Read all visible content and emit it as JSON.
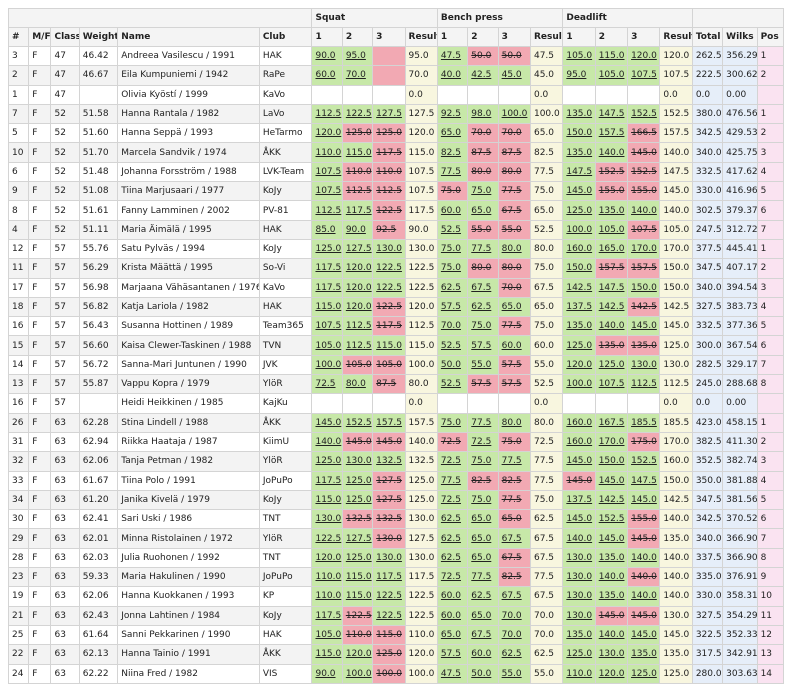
{
  "header": {
    "groups": {
      "squat": "Squat",
      "bench": "Bench press",
      "deadlift": "Deadlift"
    },
    "columns": {
      "num": "#",
      "sex": "M/F",
      "cls": "Class",
      "weight": "Weight",
      "name": "Name",
      "club": "Club",
      "a1": "1",
      "a2": "2",
      "a3": "3",
      "result": "Result",
      "total": "Total",
      "wilks": "Wilks",
      "pos": "Pos"
    }
  },
  "rows": [
    [
      "3",
      "F",
      "47",
      "46.42",
      "Andreea Vasilescu / 1991",
      "HAK",
      "90.0",
      "ok",
      "95.0",
      "ok",
      "",
      "fail",
      "95.0",
      "47.5",
      "ok",
      "50.0",
      "fail",
      "50.0",
      "fail",
      "47.5",
      "105.0",
      "ok",
      "115.0",
      "ok",
      "120.0",
      "ok",
      "120.0",
      "262.5",
      "356.29",
      "1"
    ],
    [
      "2",
      "F",
      "47",
      "46.67",
      "Eila Kumpuniemi / 1942",
      "RaPe",
      "60.0",
      "ok",
      "70.0",
      "ok",
      "",
      "fail",
      "70.0",
      "40.0",
      "ok",
      "42.5",
      "ok",
      "45.0",
      "ok",
      "45.0",
      "95.0",
      "ok",
      "105.0",
      "ok",
      "107.5",
      "ok",
      "107.5",
      "222.5",
      "300.62",
      "2"
    ],
    [
      "1",
      "F",
      "47",
      "",
      "Olivia Kyöstí / 1999",
      "KaVo",
      "",
      "",
      "",
      "",
      "",
      "",
      "0.0",
      "",
      "",
      "",
      "",
      "",
      "",
      "0.0",
      "",
      "",
      "",
      "",
      "",
      "",
      "0.0",
      "0.0",
      "0.00",
      ""
    ],
    [
      "7",
      "F",
      "52",
      "51.58",
      "Hanna Rantala / 1982",
      "LaVo",
      "112.5",
      "ok",
      "122.5",
      "ok",
      "127.5",
      "ok",
      "127.5",
      "92.5",
      "ok",
      "98.0",
      "ok",
      "100.0",
      "ok",
      "100.0",
      "135.0",
      "ok",
      "147.5",
      "ok",
      "152.5",
      "ok",
      "152.5",
      "380.0",
      "476.56",
      "1"
    ],
    [
      "5",
      "F",
      "52",
      "51.60",
      "Hanna Seppä / 1993",
      "HeTarmo",
      "120.0",
      "ok",
      "125.0",
      "fail",
      "125.0",
      "fail",
      "120.0",
      "65.0",
      "ok",
      "70.0",
      "fail",
      "70.0",
      "fail",
      "65.0",
      "150.0",
      "ok",
      "157.5",
      "ok",
      "166.5",
      "fail",
      "157.5",
      "342.5",
      "429.53",
      "2"
    ],
    [
      "10",
      "F",
      "52",
      "51.70",
      "Marcela Sandvik / 1974",
      "ÅKK",
      "110.0",
      "ok",
      "115.0",
      "ok",
      "117.5",
      "fail",
      "115.0",
      "82.5",
      "ok",
      "87.5",
      "fail",
      "87.5",
      "fail",
      "82.5",
      "135.0",
      "ok",
      "140.0",
      "ok",
      "145.0",
      "fail",
      "140.0",
      "340.0",
      "425.75",
      "3"
    ],
    [
      "6",
      "F",
      "52",
      "51.48",
      "Johanna Forsström / 1988",
      "LVK-Team",
      "107.5",
      "ok",
      "110.0",
      "fail",
      "110.0",
      "fail",
      "107.5",
      "77.5",
      "ok",
      "80.0",
      "fail",
      "80.0",
      "fail",
      "77.5",
      "147.5",
      "ok",
      "152.5",
      "fail",
      "152.5",
      "fail",
      "147.5",
      "332.5",
      "417.62",
      "4"
    ],
    [
      "9",
      "F",
      "52",
      "51.08",
      "Tiina Marjusaari / 1977",
      "KoJy",
      "107.5",
      "ok",
      "112.5",
      "fail",
      "112.5",
      "fail",
      "107.5",
      "75.0",
      "fail",
      "75.0",
      "ok",
      "77.5",
      "fail",
      "75.0",
      "145.0",
      "ok",
      "155.0",
      "fail",
      "155.0",
      "fail",
      "145.0",
      "330.0",
      "416.96",
      "5"
    ],
    [
      "8",
      "F",
      "52",
      "51.61",
      "Fanny Lamminen / 2002",
      "PV-81",
      "112.5",
      "ok",
      "117.5",
      "ok",
      "122.5",
      "fail",
      "117.5",
      "60.0",
      "ok",
      "65.0",
      "ok",
      "67.5",
      "fail",
      "65.0",
      "125.0",
      "ok",
      "135.0",
      "ok",
      "140.0",
      "ok",
      "140.0",
      "302.5",
      "379.37",
      "6"
    ],
    [
      "4",
      "F",
      "52",
      "51.11",
      "Maria Äimälä / 1995",
      "HAK",
      "85.0",
      "ok",
      "90.0",
      "ok",
      "92.5",
      "fail",
      "90.0",
      "52.5",
      "ok",
      "55.0",
      "fail",
      "55.0",
      "fail",
      "52.5",
      "100.0",
      "ok",
      "105.0",
      "ok",
      "107.5",
      "fail",
      "105.0",
      "247.5",
      "312.72",
      "7"
    ],
    [
      "12",
      "F",
      "57",
      "55.76",
      "Satu Pylväs / 1994",
      "KoJy",
      "125.0",
      "ok",
      "127.5",
      "ok",
      "130.0",
      "ok",
      "130.0",
      "75.0",
      "ok",
      "77.5",
      "ok",
      "80.0",
      "ok",
      "80.0",
      "160.0",
      "ok",
      "165.0",
      "ok",
      "170.0",
      "ok",
      "170.0",
      "377.5",
      "445.41",
      "1"
    ],
    [
      "11",
      "F",
      "57",
      "56.29",
      "Krista Määttä / 1995",
      "So-Vi",
      "117.5",
      "ok",
      "120.0",
      "ok",
      "122.5",
      "ok",
      "122.5",
      "75.0",
      "ok",
      "80.0",
      "fail",
      "80.0",
      "fail",
      "75.0",
      "150.0",
      "ok",
      "157.5",
      "fail",
      "157.5",
      "fail",
      "150.0",
      "347.5",
      "407.17",
      "2"
    ],
    [
      "17",
      "F",
      "57",
      "56.98",
      "Marjaana Vähäsantanen / 1976",
      "KaVo",
      "117.5",
      "ok",
      "120.0",
      "ok",
      "122.5",
      "ok",
      "122.5",
      "62.5",
      "ok",
      "67.5",
      "ok",
      "70.0",
      "fail",
      "67.5",
      "142.5",
      "ok",
      "147.5",
      "ok",
      "150.0",
      "ok",
      "150.0",
      "340.0",
      "394.54",
      "3"
    ],
    [
      "18",
      "F",
      "57",
      "56.82",
      "Katja Lariola / 1982",
      "HAK",
      "115.0",
      "ok",
      "120.0",
      "ok",
      "122.5",
      "fail",
      "120.0",
      "57.5",
      "ok",
      "62.5",
      "ok",
      "65.0",
      "ok",
      "65.0",
      "137.5",
      "ok",
      "142.5",
      "ok",
      "142.5",
      "fail",
      "142.5",
      "327.5",
      "383.73",
      "4"
    ],
    [
      "16",
      "F",
      "57",
      "56.43",
      "Susanna Hottinen / 1989",
      "Team365",
      "107.5",
      "ok",
      "112.5",
      "ok",
      "117.5",
      "fail",
      "112.5",
      "70.0",
      "ok",
      "75.0",
      "ok",
      "77.5",
      "fail",
      "75.0",
      "135.0",
      "ok",
      "140.0",
      "ok",
      "145.0",
      "ok",
      "145.0",
      "332.5",
      "377.36",
      "5"
    ],
    [
      "15",
      "F",
      "57",
      "56.60",
      "Kaisa Clewer-Taskinen / 1988",
      "TVN",
      "105.0",
      "ok",
      "112.5",
      "ok",
      "115.0",
      "ok",
      "115.0",
      "52.5",
      "ok",
      "57.5",
      "ok",
      "60.0",
      "ok",
      "60.0",
      "125.0",
      "ok",
      "135.0",
      "fail",
      "135.0",
      "fail",
      "125.0",
      "300.0",
      "367.54",
      "6"
    ],
    [
      "14",
      "F",
      "57",
      "56.72",
      "Sanna-Mari Juntunen / 1990",
      "JVK",
      "100.0",
      "ok",
      "105.0",
      "fail",
      "105.0",
      "fail",
      "100.0",
      "50.0",
      "ok",
      "55.0",
      "ok",
      "57.5",
      "fail",
      "55.0",
      "120.0",
      "ok",
      "125.0",
      "ok",
      "130.0",
      "ok",
      "130.0",
      "282.5",
      "329.17",
      "7"
    ],
    [
      "13",
      "F",
      "57",
      "55.87",
      "Vappu Kopra / 1979",
      "YlöR",
      "72.5",
      "ok",
      "80.0",
      "ok",
      "87.5",
      "fail",
      "80.0",
      "52.5",
      "ok",
      "57.5",
      "fail",
      "57.5",
      "fail",
      "52.5",
      "100.0",
      "ok",
      "107.5",
      "ok",
      "112.5",
      "ok",
      "112.5",
      "245.0",
      "288.68",
      "8"
    ],
    [
      "16",
      "F",
      "57",
      "",
      "Heidi Heikkinen / 1985",
      "KajKu",
      "",
      "",
      "",
      "",
      "",
      "",
      "0.0",
      "",
      "",
      "",
      "",
      "",
      "",
      "0.0",
      "",
      "",
      "",
      "",
      "",
      "",
      "0.0",
      "0.0",
      "0.00",
      ""
    ],
    [
      "26",
      "F",
      "63",
      "62.28",
      "Stina Lindell / 1988",
      "ÅKK",
      "145.0",
      "ok",
      "152.5",
      "ok",
      "157.5",
      "ok",
      "157.5",
      "75.0",
      "ok",
      "77.5",
      "ok",
      "80.0",
      "ok",
      "80.0",
      "160.0",
      "ok",
      "167.5",
      "ok",
      "185.5",
      "ok",
      "185.5",
      "423.0",
      "458.15",
      "1"
    ],
    [
      "31",
      "F",
      "63",
      "62.94",
      "Riikka Haataja / 1987",
      "KiimU",
      "140.0",
      "ok",
      "145.0",
      "fail",
      "145.0",
      "fail",
      "140.0",
      "72.5",
      "fail",
      "72.5",
      "ok",
      "75.0",
      "fail",
      "72.5",
      "160.0",
      "ok",
      "170.0",
      "ok",
      "175.0",
      "fail",
      "170.0",
      "382.5",
      "411.30",
      "2"
    ],
    [
      "32",
      "F",
      "63",
      "62.06",
      "Tanja Petman / 1982",
      "YlöR",
      "125.0",
      "ok",
      "130.0",
      "ok",
      "132.5",
      "ok",
      "132.5",
      "72.5",
      "ok",
      "75.0",
      "ok",
      "77.5",
      "ok",
      "77.5",
      "145.0",
      "ok",
      "150.0",
      "ok",
      "152.5",
      "ok",
      "160.0",
      "352.5",
      "382.74",
      "3"
    ],
    [
      "33",
      "F",
      "63",
      "61.67",
      "Tiina Polo / 1991",
      "JoPuPo",
      "117.5",
      "ok",
      "125.0",
      "ok",
      "127.5",
      "fail",
      "125.0",
      "77.5",
      "ok",
      "82.5",
      "fail",
      "82.5",
      "fail",
      "77.5",
      "145.0",
      "fail",
      "145.0",
      "ok",
      "147.5",
      "ok",
      "150.0",
      "350.0",
      "381.88",
      "4"
    ],
    [
      "34",
      "F",
      "63",
      "61.20",
      "Janika Kivelä / 1979",
      "KoJy",
      "115.0",
      "ok",
      "125.0",
      "ok",
      "127.5",
      "fail",
      "125.0",
      "72.5",
      "ok",
      "75.0",
      "ok",
      "77.5",
      "fail",
      "75.0",
      "137.5",
      "ok",
      "142.5",
      "ok",
      "145.0",
      "ok",
      "142.5",
      "347.5",
      "381.56",
      "5"
    ],
    [
      "30",
      "F",
      "63",
      "62.41",
      "Sari Uski / 1986",
      "TNT",
      "130.0",
      "ok",
      "132.5",
      "fail",
      "132.5",
      "fail",
      "130.0",
      "62.5",
      "ok",
      "65.0",
      "ok",
      "65.0",
      "fail",
      "62.5",
      "145.0",
      "ok",
      "152.5",
      "ok",
      "155.0",
      "fail",
      "140.0",
      "342.5",
      "370.52",
      "6"
    ],
    [
      "29",
      "F",
      "63",
      "62.01",
      "Minna Ristolainen / 1972",
      "YlöR",
      "122.5",
      "ok",
      "127.5",
      "ok",
      "130.0",
      "fail",
      "127.5",
      "62.5",
      "ok",
      "65.0",
      "ok",
      "67.5",
      "ok",
      "67.5",
      "140.0",
      "ok",
      "145.0",
      "ok",
      "145.0",
      "fail",
      "135.0",
      "340.0",
      "366.90",
      "7"
    ],
    [
      "28",
      "F",
      "63",
      "62.03",
      "Julia Ruohonen / 1992",
      "TNT",
      "120.0",
      "ok",
      "125.0",
      "ok",
      "130.0",
      "ok",
      "130.0",
      "62.5",
      "ok",
      "65.0",
      "ok",
      "67.5",
      "fail",
      "67.5",
      "130.0",
      "ok",
      "135.0",
      "ok",
      "140.0",
      "ok",
      "140.0",
      "337.5",
      "366.90",
      "8"
    ],
    [
      "23",
      "F",
      "63",
      "59.33",
      "Maria Hakulinen / 1990",
      "JoPuPo",
      "110.0",
      "ok",
      "115.0",
      "ok",
      "117.5",
      "ok",
      "117.5",
      "72.5",
      "ok",
      "77.5",
      "ok",
      "82.5",
      "fail",
      "77.5",
      "130.0",
      "ok",
      "140.0",
      "ok",
      "140.0",
      "fail",
      "140.0",
      "335.0",
      "376.91",
      "9"
    ],
    [
      "19",
      "F",
      "63",
      "62.06",
      "Hanna Kuokkanen / 1993",
      "KP",
      "110.0",
      "ok",
      "115.0",
      "ok",
      "122.5",
      "ok",
      "122.5",
      "60.0",
      "ok",
      "62.5",
      "ok",
      "67.5",
      "ok",
      "67.5",
      "130.0",
      "ok",
      "135.0",
      "ok",
      "140.0",
      "ok",
      "140.0",
      "330.0",
      "358.31",
      "10"
    ],
    [
      "21",
      "F",
      "63",
      "62.43",
      "Jonna Lahtinen / 1984",
      "KoJy",
      "117.5",
      "ok",
      "122.5",
      "fail",
      "122.5",
      "ok",
      "122.5",
      "60.0",
      "ok",
      "65.0",
      "ok",
      "70.0",
      "ok",
      "70.0",
      "130.0",
      "ok",
      "145.0",
      "fail",
      "145.0",
      "fail",
      "130.0",
      "327.5",
      "354.29",
      "11"
    ],
    [
      "25",
      "F",
      "63",
      "61.64",
      "Sanni Pekkarinen / 1990",
      "HAK",
      "105.0",
      "ok",
      "110.0",
      "fail",
      "115.0",
      "fail",
      "110.0",
      "65.0",
      "ok",
      "67.5",
      "ok",
      "70.0",
      "ok",
      "70.0",
      "135.0",
      "ok",
      "140.0",
      "ok",
      "145.0",
      "ok",
      "145.0",
      "322.5",
      "352.33",
      "12"
    ],
    [
      "22",
      "F",
      "63",
      "62.13",
      "Hanna Tainio / 1991",
      "ÅKK",
      "115.0",
      "ok",
      "120.0",
      "ok",
      "125.0",
      "fail",
      "120.0",
      "57.5",
      "ok",
      "60.0",
      "ok",
      "62.5",
      "ok",
      "62.5",
      "125.0",
      "ok",
      "130.0",
      "ok",
      "135.0",
      "ok",
      "135.0",
      "317.5",
      "342.91",
      "13"
    ],
    [
      "24",
      "F",
      "63",
      "62.22",
      "Niina Fred / 1982",
      "VIS",
      "90.0",
      "ok",
      "100.0",
      "ok",
      "100.0",
      "fail",
      "100.0",
      "47.5",
      "ok",
      "50.0",
      "ok",
      "55.0",
      "ok",
      "55.0",
      "110.0",
      "ok",
      "120.0",
      "ok",
      "125.0",
      "ok",
      "125.0",
      "280.0",
      "303.63",
      "14"
    ]
  ]
}
